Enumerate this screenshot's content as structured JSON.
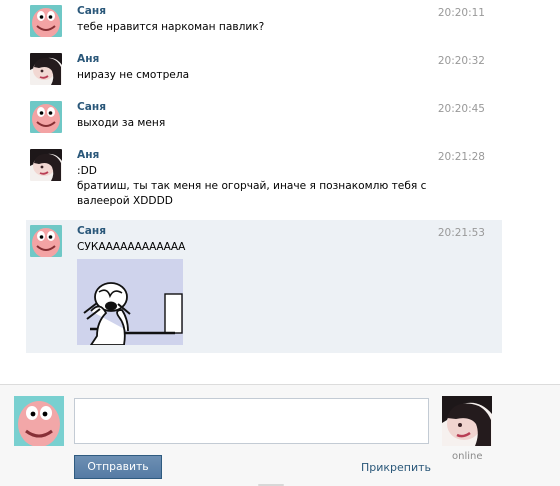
{
  "messages": [
    {
      "author": "Саня",
      "time": "20:20:11",
      "text": "тебе нравится наркоман павлик?",
      "avatar": "patrick-avatar"
    },
    {
      "author": "Аня",
      "time": "20:20:32",
      "text": "ниразу не смотрела",
      "avatar": "anya-avatar"
    },
    {
      "author": "Саня",
      "time": "20:20:45",
      "text": "выходи за меня",
      "avatar": "patrick-avatar"
    },
    {
      "author": "Аня",
      "time": "20:21:28",
      "text": ":DD\nбратииш, ты так меня не огорчай, иначе я познакомлю тебя с\nвалеерой XDDDD",
      "avatar": "anya-avatar"
    },
    {
      "author": "Саня",
      "time": "20:21:53",
      "text": "СУКАААААААААААА",
      "avatar": "patrick-avatar",
      "attachment": "rage-comic-meme"
    }
  ],
  "composer": {
    "send_label": "Отправить",
    "attach_label": "Прикрепить",
    "status": "online",
    "input_value": "",
    "input_placeholder": ""
  },
  "colors": {
    "link_blue": "#2b587a",
    "button_blue": "#5b7fa5",
    "selected_bg": "#edf1f5",
    "time_gray": "#999999"
  }
}
